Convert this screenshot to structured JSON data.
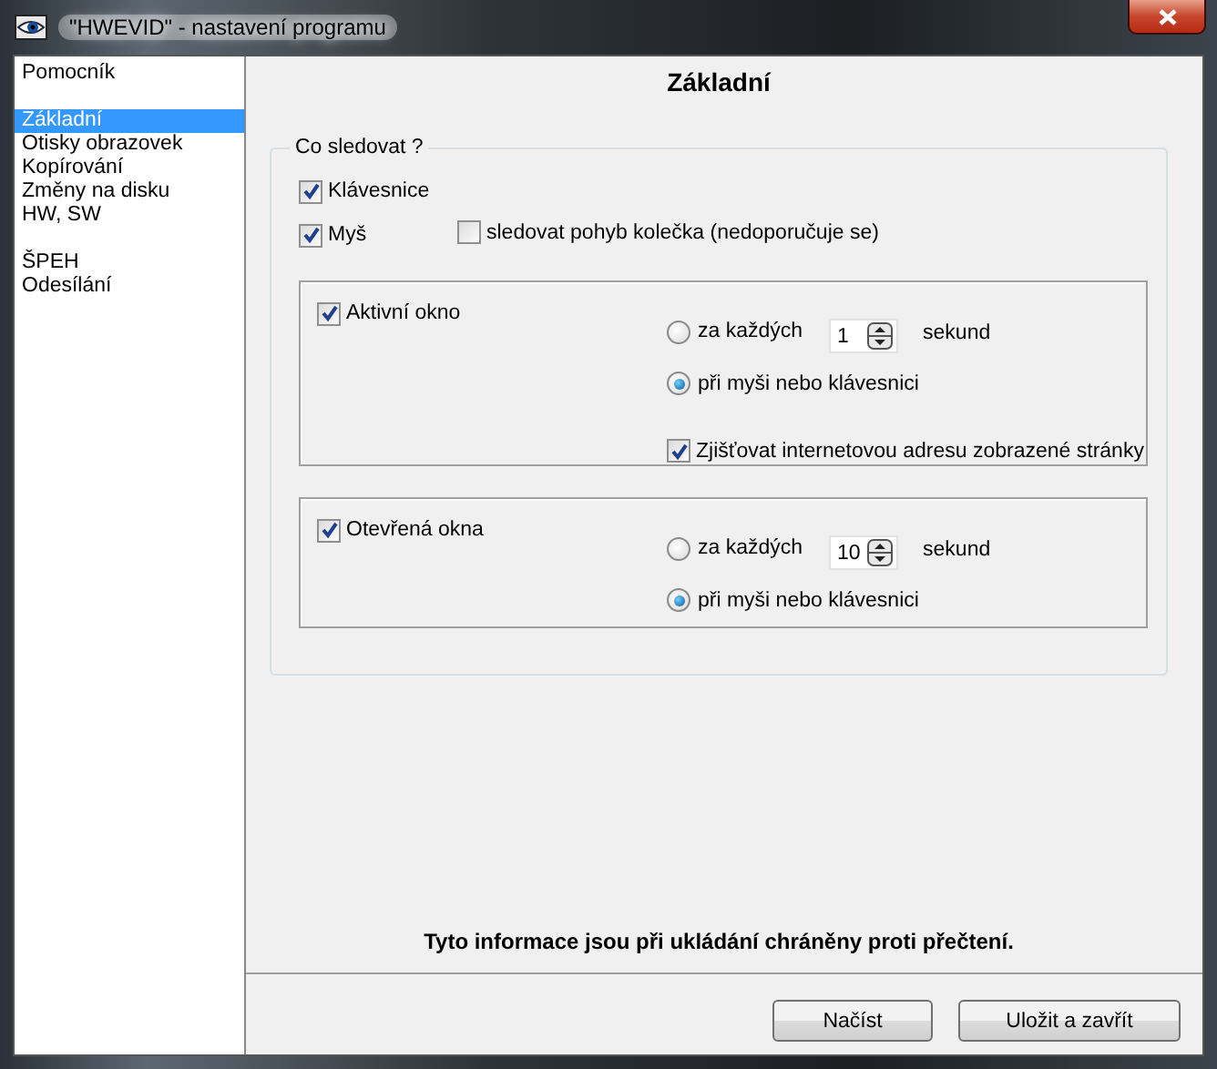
{
  "window": {
    "title": "\"HWEVID\" - nastavení programu"
  },
  "sidebar": {
    "groups": [
      {
        "items": [
          {
            "label": "Pomocník",
            "selected": false
          }
        ]
      },
      {
        "items": [
          {
            "label": "Základní",
            "selected": true
          },
          {
            "label": "Otisky obrazovek",
            "selected": false
          },
          {
            "label": "Kopírování",
            "selected": false
          },
          {
            "label": "Změny na disku",
            "selected": false
          },
          {
            "label": "HW, SW",
            "selected": false
          }
        ]
      },
      {
        "items": [
          {
            "label": "ŠPEH",
            "selected": false
          },
          {
            "label": "Odesílání",
            "selected": false
          }
        ]
      }
    ]
  },
  "page": {
    "heading": "Základní",
    "group": {
      "title": "Co sledovat ?",
      "options": [
        {
          "label": "Klávesnice",
          "checked": true
        },
        {
          "label": "Myš",
          "checked": true,
          "extra": {
            "label": "sledovat pohyb kolečka (nedoporučuje se)",
            "checked": false
          }
        }
      ],
      "sections": [
        {
          "label": "Aktivní okno",
          "checked": true,
          "interval": {
            "label": "za každých",
            "value": "1",
            "unit": "sekund",
            "selected": false
          },
          "on_input": {
            "label": "při myši nebo klávesnici",
            "selected": true
          },
          "extra": {
            "label": "Zjišťovat internetovou adresu zobrazené stránky",
            "checked": true
          }
        },
        {
          "label": "Otevřená okna",
          "checked": true,
          "interval": {
            "label": "za každých",
            "value": "10",
            "unit": "sekund",
            "selected": false
          },
          "on_input": {
            "label": "při myši nebo klávesnici",
            "selected": true
          }
        }
      ]
    },
    "note": "Tyto informace jsou při ukládání chráněny proti přečtení."
  },
  "buttons": [
    {
      "label": "Načíst"
    },
    {
      "label": "Uložit a zavřít"
    }
  ]
}
